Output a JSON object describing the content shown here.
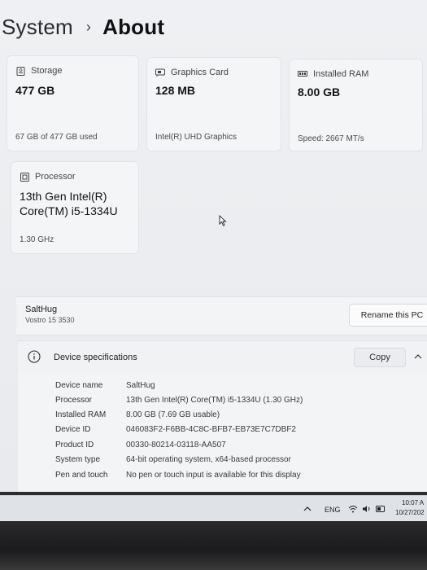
{
  "breadcrumb": {
    "root": "System",
    "separator": "›",
    "current": "About"
  },
  "cards": {
    "storage": {
      "icon": "storage-icon",
      "label": "Storage",
      "value": "477 GB",
      "detail": "67 GB of 477 GB used"
    },
    "graphics": {
      "icon": "graphics-card-icon",
      "label": "Graphics Card",
      "value": "128 MB",
      "detail": "Intel(R) UHD Graphics"
    },
    "ram": {
      "icon": "ram-icon",
      "label": "Installed RAM",
      "value": "8.00 GB",
      "detail": "Speed: 2667 MT/s"
    },
    "processor": {
      "icon": "processor-icon",
      "label": "Processor",
      "value_line1": "13th Gen Intel(R)",
      "value_line2": "Core(TM) i5-1334U",
      "detail": "1.30 GHz"
    }
  },
  "device": {
    "name": "SaltHug",
    "model": "Vostro 15 3530",
    "rename_label": "Rename this PC"
  },
  "specs": {
    "title": "Device specifications",
    "copy_label": "Copy",
    "rows": [
      {
        "key": "Device name",
        "value": "SaltHug"
      },
      {
        "key": "Processor",
        "value": "13th Gen Intel(R) Core(TM) i5-1334U (1.30 GHz)"
      },
      {
        "key": "Installed RAM",
        "value": "8.00 GB (7.69 GB usable)"
      },
      {
        "key": "Device ID",
        "value": "046083F2-F6BB-4C8C-BFB7-EB73E7C7DBF2"
      },
      {
        "key": "Product ID",
        "value": "00330-80214-03118-AA507"
      },
      {
        "key": "System type",
        "value": "64-bit operating system, x64-based processor"
      },
      {
        "key": "Pen and touch",
        "value": "No pen or touch input is available for this display"
      }
    ]
  },
  "taskbar": {
    "language": "ENG",
    "time": "10:07 A",
    "date": "10/27/202"
  },
  "colors": {
    "background": "#eef0f3",
    "card": "#f4f5f7",
    "bezel": "#1b1b1d"
  }
}
